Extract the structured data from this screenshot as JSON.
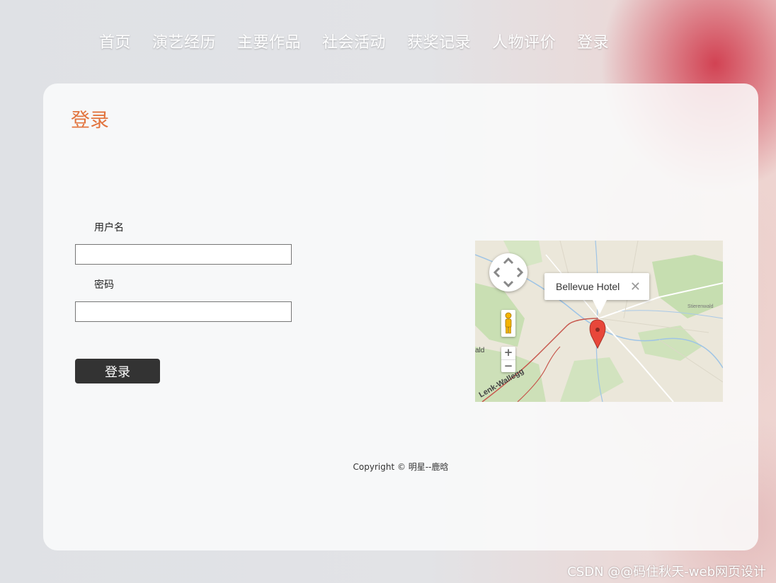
{
  "nav": {
    "items": [
      "首页",
      "演艺经历",
      "主要作品",
      "社会活动",
      "获奖记录",
      "人物评价",
      "登录"
    ]
  },
  "login": {
    "title": "登录",
    "username_label": "用户名",
    "password_label": "密码",
    "username_value": "",
    "password_value": "",
    "submit_label": "登录"
  },
  "map": {
    "info_title": "Bellevue Hotel",
    "info_close": "✕",
    "zoom_in": "+",
    "zoom_out": "−",
    "labels": [
      "Lenk-Wallegg",
      "ald",
      "Stierenwald"
    ]
  },
  "footer": {
    "copyright": "Copyright © 明星--鹿晗"
  },
  "watermark": "CSDN @@码住秋天-web网页设计",
  "colors": {
    "accent": "#e2743e",
    "button_bg": "#333333",
    "marker": "#e8473a"
  }
}
